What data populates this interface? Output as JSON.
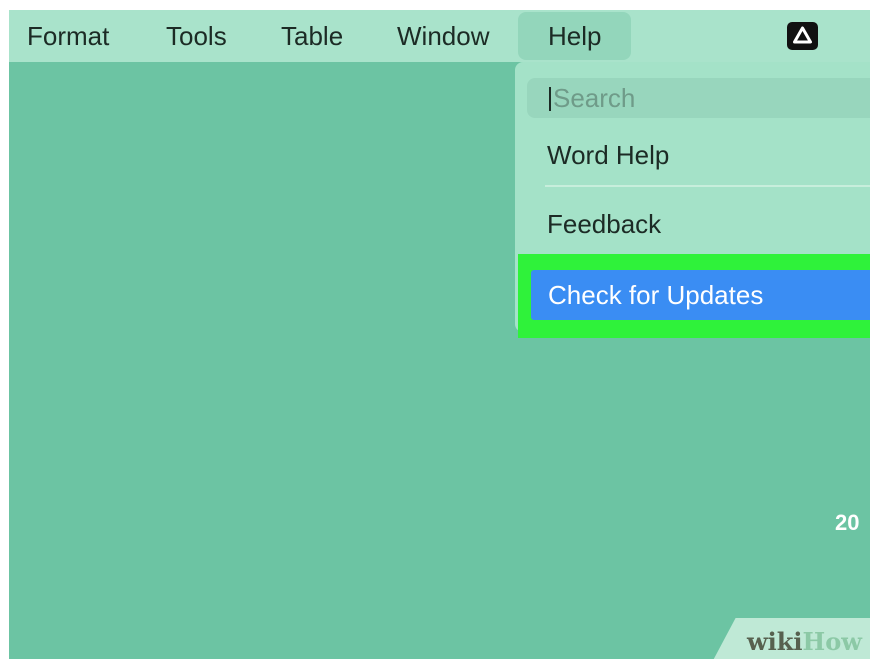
{
  "menubar": {
    "items": [
      {
        "label": "Format"
      },
      {
        "label": "Tools"
      },
      {
        "label": "Table"
      },
      {
        "label": "Window"
      },
      {
        "label": "Help"
      }
    ],
    "status_icon": "google-drive-icon"
  },
  "help_menu": {
    "search": {
      "placeholder": "Search"
    },
    "items": [
      {
        "label": "Word Help"
      },
      {
        "label": "Feedback"
      },
      {
        "label": "Check for Updates",
        "highlighted": true
      }
    ],
    "highlight_color": "#3a8df3",
    "callout_color": "#2ff23a"
  },
  "desktop": {
    "clock_partial": "20"
  },
  "watermark": {
    "wiki": "wiki",
    "how": "How"
  },
  "colors": {
    "background": "#6cc4a3",
    "menubar": "#a9e3cb",
    "menu_text": "#1c2b25"
  }
}
